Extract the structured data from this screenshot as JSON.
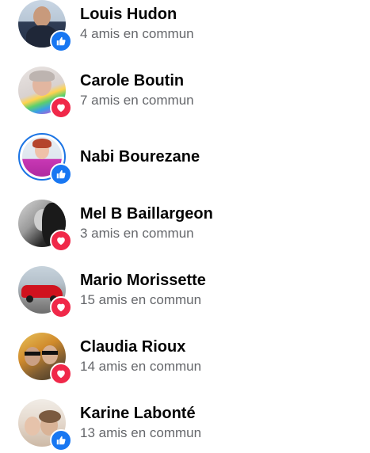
{
  "colors": {
    "like_badge": "#1877f2",
    "love_badge": "#f02849",
    "story_ring": "#1b74e4",
    "name_text": "#050505",
    "secondary_text": "#65676b"
  },
  "people": [
    {
      "name": "Louis Hudon",
      "mutual": "4 amis en commun",
      "reaction": "like-icon",
      "ring": false
    },
    {
      "name": "Carole Boutin",
      "mutual": "7 amis en commun",
      "reaction": "love-icon",
      "ring": false
    },
    {
      "name": "Nabi Bourezane",
      "mutual": "",
      "reaction": "like-icon",
      "ring": true
    },
    {
      "name": "Mel B Baillargeon",
      "mutual": "3 amis en commun",
      "reaction": "love-icon",
      "ring": false
    },
    {
      "name": "Mario Morissette",
      "mutual": "15 amis en commun",
      "reaction": "love-icon",
      "ring": false
    },
    {
      "name": "Claudia Rioux",
      "mutual": "14 amis en commun",
      "reaction": "love-icon",
      "ring": false
    },
    {
      "name": "Karine Labonté",
      "mutual": "13 amis en commun",
      "reaction": "like-icon",
      "ring": false
    }
  ]
}
